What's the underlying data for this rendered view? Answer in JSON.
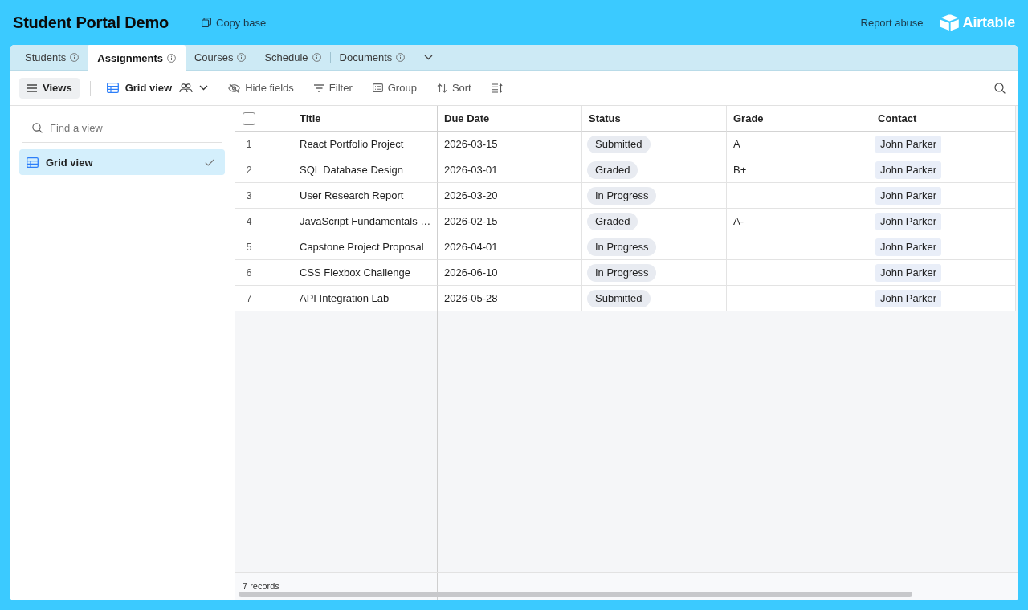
{
  "header": {
    "title": "Student Portal Demo",
    "copy_button": "Copy base",
    "report_link": "Report abuse",
    "logo": "Airtable"
  },
  "tabs": [
    {
      "label": "Students",
      "selected": false
    },
    {
      "label": "Assignments",
      "selected": true
    },
    {
      "label": "Courses",
      "selected": false
    },
    {
      "label": "Schedule",
      "selected": false
    },
    {
      "label": "Documents",
      "selected": false
    }
  ],
  "toolbar": {
    "views_button": "Views",
    "view_name": "Grid view",
    "hide_fields": "Hide fields",
    "filter": "Filter",
    "group": "Group",
    "sort": "Sort"
  },
  "sidebar": {
    "search": {
      "placeholder": "Find a view"
    },
    "views": [
      {
        "label": "Grid view",
        "selected": true
      }
    ]
  },
  "table": {
    "header_checkbox": {
      "checked": false
    },
    "columns": [
      "Title",
      "Due Date",
      "Status",
      "Grade",
      "Contact"
    ],
    "rows": [
      {
        "number": "1",
        "title": "React Portfolio Project",
        "due_date": "2026-03-15",
        "status": "Submitted",
        "grade": "A",
        "contact": "John Parker"
      },
      {
        "number": "2",
        "title": "SQL Database Design",
        "due_date": "2026-03-01",
        "status": "Graded",
        "grade": "B+",
        "contact": "John Parker"
      },
      {
        "number": "3",
        "title": "User Research Report",
        "due_date": "2026-03-20",
        "status": "In Progress",
        "contact": "John Parker"
      },
      {
        "number": "4",
        "title": "JavaScript Fundamentals …",
        "due_date": "2026-02-15",
        "status": "Graded",
        "grade": "A-",
        "contact": "John Parker"
      },
      {
        "number": "5",
        "title": "Capstone Project Proposal",
        "due_date": "2026-04-01",
        "status": "In Progress",
        "contact": "John Parker"
      },
      {
        "number": "6",
        "title": "CSS Flexbox Challenge",
        "due_date": "2026-06-10",
        "status": "In Progress",
        "contact": "John Parker"
      },
      {
        "number": "7",
        "title": "API Integration Lab",
        "due_date": "2026-05-28",
        "status": "Submitted",
        "contact": "John Parker"
      }
    ]
  },
  "footer": {
    "record_count": "7 records"
  }
}
